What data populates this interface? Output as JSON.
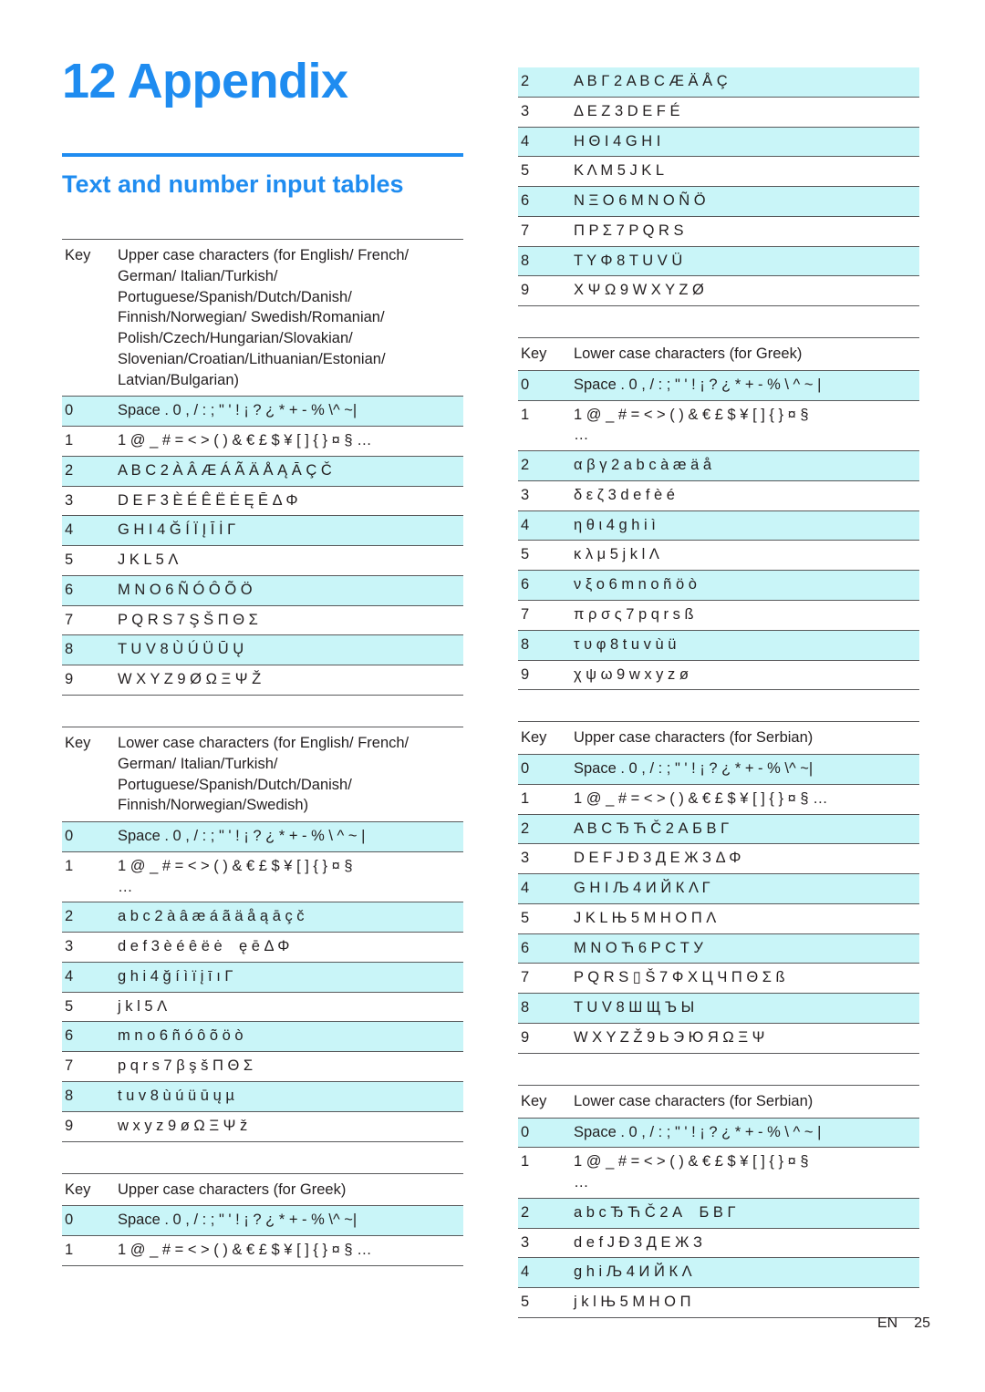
{
  "header": {
    "chapter_number": "12",
    "chapter_title": "Appendix",
    "chapter_heading": "12 Appendix",
    "section_title": "Text and number input tables",
    "accent_color": "#1f8cf0"
  },
  "footer": {
    "language": "EN",
    "page_number": "25"
  },
  "common": {
    "key_label": "Key",
    "row0_chars": "Space . 0 , / : ; \" ' ! ¡ ? ¿ * + - % \\ ^ ~ |",
    "row1_chars": "1 @ _ # = < > ( ) & € £ $ ¥ [ ] { } ¤ §",
    "continuation": "…"
  },
  "tables": [
    {
      "id": "latin-upper",
      "column": "left",
      "header_key": "Key",
      "header_desc": "Upper case characters (for English/ French/ German/ Italian/Turkish/ Portuguese/Spanish/Dutch/Danish/ Finnish/Norwegian/ Swedish/Romanian/ Polish/Czech/Hungarian/Slovakian/ Slovenian/Croatian/Lithuanian/Estonian/ Latvian/Bulgarian)",
      "rows": [
        {
          "key": "0",
          "chars": "Space . 0 , / : ; \" ' ! ¡ ? ¿ * + - % \\^ ~|",
          "shaded": true
        },
        {
          "key": "1",
          "chars": "1 @ _ # = < > ( ) & € £ $ ¥ [ ] { } ¤ § …",
          "shaded": false
        },
        {
          "key": "2",
          "chars": "A B C 2 À Â Æ Á Ã Ä Å Ą Ā Ç Č",
          "shaded": true
        },
        {
          "key": "3",
          "chars": "D E F 3 È É Ê Ë Ė Ę Ē Δ Φ",
          "shaded": false
        },
        {
          "key": "4",
          "chars": "G H I 4 Ğ Í Ï Į Ī İ Γ",
          "shaded": true
        },
        {
          "key": "5",
          "chars": "J K L 5 Λ",
          "shaded": false
        },
        {
          "key": "6",
          "chars": "M N O 6 Ñ Ó Ô Õ Ö",
          "shaded": true
        },
        {
          "key": "7",
          "chars": "P Q R S 7 Ş Š Π Θ Σ",
          "shaded": false
        },
        {
          "key": "8",
          "chars": "T U V 8 Ù Ú Ü Ū Ų",
          "shaded": true
        },
        {
          "key": "9",
          "chars": "W X Y Z 9 Ø Ω Ξ Ψ Ž",
          "shaded": false
        }
      ]
    },
    {
      "id": "latin-lower",
      "column": "left",
      "header_key": "Key",
      "header_desc": "Lower case characters (for English/ French/ German/ Italian/Turkish/ Portuguese/Spanish/Dutch/Danish/ Finnish/Norwegian/Swedish)",
      "rows": [
        {
          "key": "0",
          "chars": "Space . 0 , / : ; \" ' ! ¡ ? ¿ * + - % \\ ^ ~ |",
          "shaded": true
        },
        {
          "key": "1",
          "chars": "1 @ _ # = < > ( ) & € £ $ ¥ [ ] { } ¤ §",
          "continuation": "…",
          "shaded": false
        },
        {
          "key": "2",
          "chars": "a b c 2 à â æ á ã ä å ą ā ç č",
          "shaded": true
        },
        {
          "key": "3",
          "chars": "d e f 3 è é ê ë ė    ę ē Δ Φ",
          "shaded": false
        },
        {
          "key": "4",
          "chars": "g h i 4 ğ í ì ï į ī ı Γ",
          "shaded": true
        },
        {
          "key": "5",
          "chars": "j k l 5 Λ",
          "shaded": false
        },
        {
          "key": "6",
          "chars": "m n o 6 ñ ó ô õ ö ò",
          "shaded": true
        },
        {
          "key": "7",
          "chars": "p q r s 7 β ş š Π Θ Σ",
          "shaded": false
        },
        {
          "key": "8",
          "chars": "t u v 8 ù ú ü ū ų µ",
          "shaded": true
        },
        {
          "key": "9",
          "chars": "w x y z 9 ø Ω Ξ Ψ ž",
          "shaded": false
        }
      ]
    },
    {
      "id": "greek-upper",
      "column": "split",
      "header_key": "Key",
      "header_desc": "Upper case characters (for Greek)",
      "rows": [
        {
          "key": "0",
          "chars": "Space . 0 , / : ; \" ' ! ¡ ? ¿ * + - % \\^ ~|",
          "shaded": true
        },
        {
          "key": "1",
          "chars": "1 @ _ # = < > ( ) & € £ $ ¥ [ ] { } ¤ § …",
          "shaded": false
        },
        {
          "key": "2",
          "chars": "Α Β Γ 2 A B C Æ Ä Å Ç",
          "shaded": true
        },
        {
          "key": "3",
          "chars": "Δ Ε Ζ 3 D E F É",
          "shaded": false
        },
        {
          "key": "4",
          "chars": "Η Θ Ι 4 G H I",
          "shaded": true
        },
        {
          "key": "5",
          "chars": "Κ Λ Μ 5 J K L",
          "shaded": false
        },
        {
          "key": "6",
          "chars": "Ν Ξ Ο 6 M N O Ñ Ö",
          "shaded": true
        },
        {
          "key": "7",
          "chars": "Π Ρ Σ 7 P Q R S",
          "shaded": false
        },
        {
          "key": "8",
          "chars": "Τ Υ Φ 8 T U V Ü",
          "shaded": true
        },
        {
          "key": "9",
          "chars": "Χ Ψ Ω 9 W X Y Z Ø",
          "shaded": false
        }
      ]
    },
    {
      "id": "greek-lower",
      "column": "right",
      "header_key": "Key",
      "header_desc": "Lower case characters (for Greek)",
      "rows": [
        {
          "key": "0",
          "chars": "Space . 0 , / : ; \" ' ! ¡ ? ¿ * + - % \\ ^ ~ |",
          "shaded": true
        },
        {
          "key": "1",
          "chars": "1 @ _ # = < > ( ) & € £ $ ¥ [ ] { } ¤ §",
          "continuation": "…",
          "shaded": false
        },
        {
          "key": "2",
          "chars": "α β γ 2 a b c à æ ä å",
          "shaded": true
        },
        {
          "key": "3",
          "chars": "δ ε ζ 3 d e f è é",
          "shaded": false
        },
        {
          "key": "4",
          "chars": "η θ ι 4 g h i ì",
          "shaded": true
        },
        {
          "key": "5",
          "chars": "κ λ μ 5 j k l Λ",
          "shaded": false
        },
        {
          "key": "6",
          "chars": "ν ξ ο 6 m n o ñ ö ò",
          "shaded": true
        },
        {
          "key": "7",
          "chars": "π ρ σ ς 7 p q r s ß",
          "shaded": false
        },
        {
          "key": "8",
          "chars": "τ υ φ 8 t u v ù ü",
          "shaded": true
        },
        {
          "key": "9",
          "chars": "χ ψ ω 9 w x y z ø",
          "shaded": false
        }
      ]
    },
    {
      "id": "serbian-upper",
      "column": "right",
      "header_key": "Key",
      "header_desc": "Upper case characters (for Serbian)",
      "rows": [
        {
          "key": "0",
          "chars": "Space . 0 , / : ; \" ' ! ¡ ? ¿ * + - % \\^ ~|",
          "shaded": true
        },
        {
          "key": "1",
          "chars": "1 @ _ # = < > ( ) & € £ $ ¥ [ ] { } ¤ § …",
          "shaded": false
        },
        {
          "key": "2",
          "chars": "A B C Ђ Ћ Č 2 А Б В Г",
          "shaded": true
        },
        {
          "key": "3",
          "chars": "D E F J Đ 3 Д Е Ж З Δ Φ",
          "shaded": false
        },
        {
          "key": "4",
          "chars": "G H I Љ 4 И Й К Λ Γ",
          "shaded": true
        },
        {
          "key": "5",
          "chars": "J K L Њ 5 М Н О П Λ",
          "shaded": false
        },
        {
          "key": "6",
          "chars": "M N O Ћ 6 Р С Т У",
          "shaded": true
        },
        {
          "key": "7",
          "chars": "P Q R S ▯ Š 7 Ф Х Ц Ч П Θ Σ ß",
          "shaded": false
        },
        {
          "key": "8",
          "chars": "T U V 8 Ш Щ Ъ Ы",
          "shaded": true
        },
        {
          "key": "9",
          "chars": "W X Y Z Ž 9 Ь Э Ю Я Ω Ξ Ψ",
          "shaded": false
        }
      ]
    },
    {
      "id": "serbian-lower",
      "column": "right",
      "header_key": "Key",
      "header_desc": "Lower case characters (for Serbian)",
      "rows": [
        {
          "key": "0",
          "chars": "Space . 0 , / : ; \" ' ! ¡ ? ¿ * + - % \\ ^ ~ |",
          "shaded": true
        },
        {
          "key": "1",
          "chars": "1 @ _ # = < > ( ) & € £ $ ¥ [ ] { } ¤ §",
          "continuation": "…",
          "shaded": false
        },
        {
          "key": "2",
          "chars": "a b c Ђ Ћ Č 2 А    Б В Г",
          "shaded": true
        },
        {
          "key": "3",
          "chars": "d e f J Đ 3 Д Е Ж З",
          "shaded": false
        },
        {
          "key": "4",
          "chars": "g h i Љ 4 И Й К Λ",
          "shaded": true
        },
        {
          "key": "5",
          "chars": "j k l Њ 5 М Н О П",
          "shaded": false
        }
      ]
    }
  ]
}
